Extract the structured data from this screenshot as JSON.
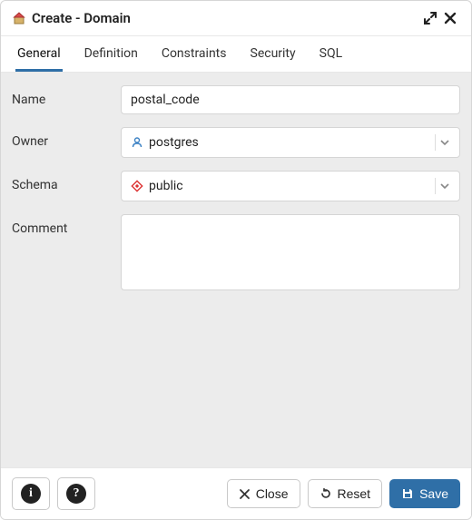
{
  "header": {
    "title": "Create - Domain"
  },
  "tabs": [
    {
      "label": "General",
      "active": true
    },
    {
      "label": "Definition"
    },
    {
      "label": "Constraints"
    },
    {
      "label": "Security"
    },
    {
      "label": "SQL"
    }
  ],
  "form": {
    "name": {
      "label": "Name",
      "value": "postal_code"
    },
    "owner": {
      "label": "Owner",
      "value": "postgres"
    },
    "schema": {
      "label": "Schema",
      "value": "public"
    },
    "comment": {
      "label": "Comment",
      "value": ""
    }
  },
  "footer": {
    "close": "Close",
    "reset": "Reset",
    "save": "Save"
  }
}
